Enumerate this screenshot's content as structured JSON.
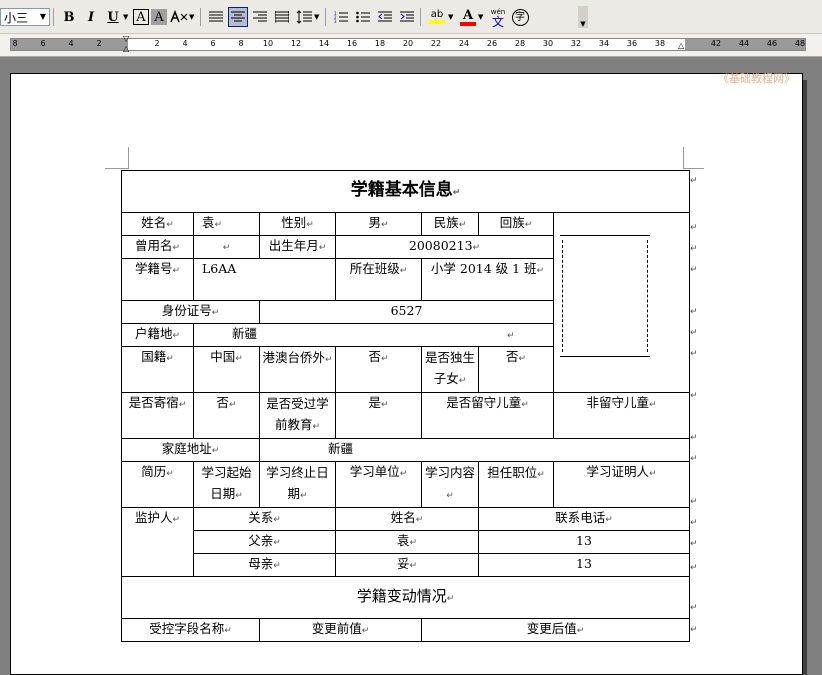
{
  "toolbar": {
    "font_size": "小三",
    "bold": "B",
    "italic": "I",
    "underline": "U",
    "char_border": "A",
    "char_shading": "A",
    "highlight_label": "ab",
    "font_color": "A",
    "phonetic_top": "wén",
    "phonetic_bottom": "文",
    "enclose": "字"
  },
  "ruler": {
    "ticks": [
      "8",
      "6",
      "4",
      "2",
      "2",
      "4",
      "6",
      "8",
      "10",
      "12",
      "14",
      "16",
      "18",
      "20",
      "22",
      "24",
      "26",
      "28",
      "30",
      "32",
      "34",
      "36",
      "38",
      "42",
      "44",
      "46",
      "48"
    ]
  },
  "watermark": "《基础教程网》",
  "paragraph_mark": "↵",
  "form": {
    "title": "学籍基本信息",
    "name_label": "姓名",
    "name_value": "袁",
    "gender_label": "性别",
    "gender_value": "男",
    "ethnicity_label": "民族",
    "ethnicity_value": "回族",
    "former_name_label": "曾用名",
    "birth_label": "出生年月",
    "birth_value": "20080213",
    "student_no_label": "学籍号",
    "student_no_value": "L6AA",
    "class_label": "所在班级",
    "class_value": "小学 2014 级 1 班",
    "id_label": "身份证号",
    "id_value": "6527",
    "household_label": "户籍地",
    "household_value": "新疆",
    "nationality_label": "国籍",
    "nationality_value": "中国",
    "overseas_label": "港澳台侨外",
    "overseas_value": "否",
    "only_child_label": "是否独生子女",
    "only_child_value": "否",
    "boarding_label": "是否寄宿",
    "boarding_value": "否",
    "preschool_label": "是否受过学前教育",
    "preschool_value": "是",
    "left_behind_label": "是否留守儿童",
    "left_behind_value": "非留守儿童",
    "address_label": "家庭地址",
    "address_value": "新疆",
    "resume_label": "简历",
    "resume_headers": [
      "学习起始日期",
      "学习终止日期",
      "学习单位",
      "学习内容",
      "担任职位",
      "学习证明人"
    ],
    "guardian_label": "监护人",
    "guardian_headers": [
      "关系",
      "姓名",
      "联系电话"
    ],
    "guardians": [
      {
        "relation": "父亲",
        "name": "袁",
        "phone": "13"
      },
      {
        "relation": "母亲",
        "name": "妥",
        "phone": "13"
      }
    ],
    "changes_title": "学籍变动情况",
    "changes_headers": [
      "受控字段名称",
      "变更前值",
      "变更后值"
    ]
  }
}
